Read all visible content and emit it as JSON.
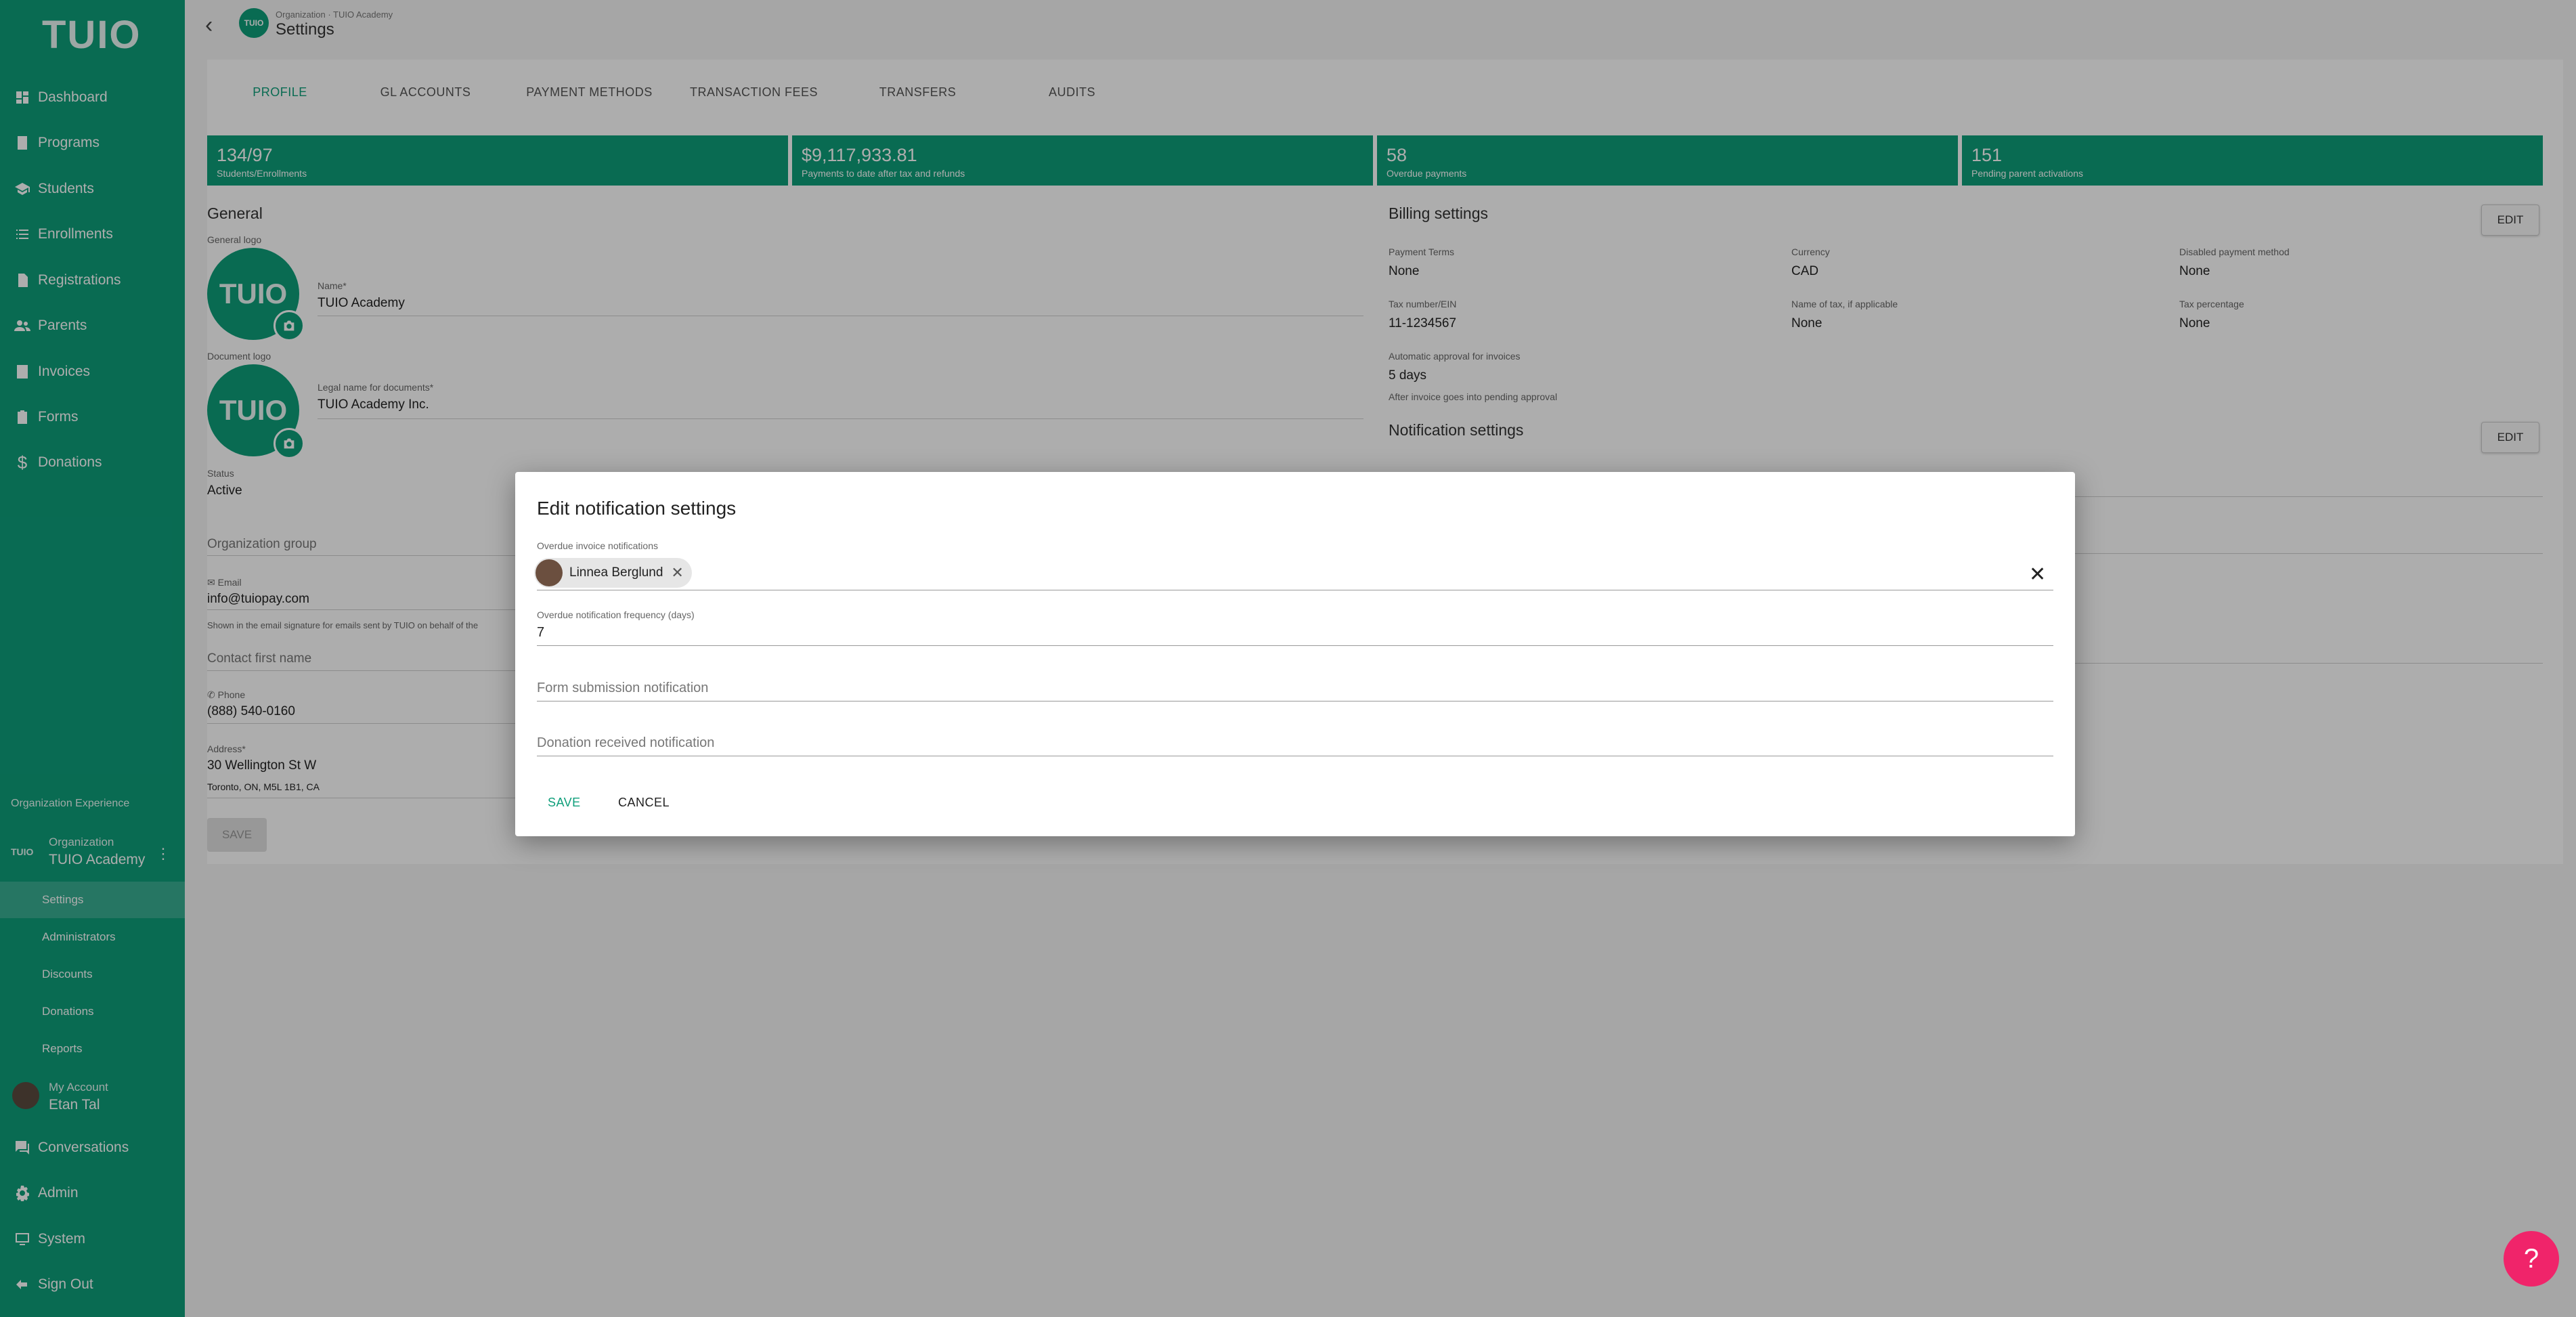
{
  "sidebar": {
    "logo": "TUIO",
    "nav": [
      {
        "label": "Dashboard",
        "icon": "dashboard-icon"
      },
      {
        "label": "Programs",
        "icon": "programs-icon"
      },
      {
        "label": "Students",
        "icon": "students-icon"
      },
      {
        "label": "Enrollments",
        "icon": "list-icon"
      },
      {
        "label": "Registrations",
        "icon": "registrations-icon"
      },
      {
        "label": "Parents",
        "icon": "parents-icon"
      },
      {
        "label": "Invoices",
        "icon": "invoices-icon"
      },
      {
        "label": "Forms",
        "icon": "forms-icon"
      },
      {
        "label": "Donations",
        "icon": "dollar-icon"
      }
    ],
    "org_experience": "Organization Experience",
    "org": {
      "tag": "TUIO",
      "label": "Organization",
      "name": "TUIO Academy"
    },
    "sub_items": [
      "Settings",
      "Administrators",
      "Discounts",
      "Donations",
      "Reports"
    ],
    "account": {
      "label": "My Account",
      "name": "Etan Tal"
    },
    "bottom_nav": [
      {
        "label": "Conversations",
        "icon": "chat-icon"
      },
      {
        "label": "Admin",
        "icon": "gear-icon"
      },
      {
        "label": "System",
        "icon": "monitor-icon"
      },
      {
        "label": "Sign Out",
        "icon": "sign-out-icon"
      }
    ]
  },
  "header": {
    "badge": "TUIO",
    "breadcrumb": "Organization · TUIO Academy",
    "title": "Settings"
  },
  "tabs": [
    "PROFILE",
    "GL ACCOUNTS",
    "PAYMENT METHODS",
    "TRANSACTION FEES",
    "TRANSFERS",
    "AUDITS"
  ],
  "stats": [
    {
      "value": "134/97",
      "label": "Students/Enrollments"
    },
    {
      "value": "$9,117,933.81",
      "label": "Payments to date after tax and refunds"
    },
    {
      "value": "58",
      "label": "Overdue payments"
    },
    {
      "value": "151",
      "label": "Pending parent activations"
    }
  ],
  "general": {
    "heading": "General",
    "general_logo_label": "General logo",
    "document_logo_label": "Document logo",
    "logo_text": "TUIO",
    "name_label": "Name*",
    "name_value": "TUIO Academy",
    "legal_label": "Legal name for documents*",
    "legal_value": "TUIO Academy Inc.",
    "status_label": "Status",
    "status_value": "Active",
    "org_group_label": "Organization group",
    "email_label": "Email",
    "email_value": "info@tuiopay.com",
    "email_help": "Shown in the email signature for emails sent by TUIO on behalf of the",
    "contact_label": "Contact first name",
    "phone_label": "Phone",
    "phone_value": "(888) 540-0160",
    "address_label": "Address*",
    "address_line1": "30 Wellington St W",
    "address_line2": "Toronto, ON, M5L 1B1, CA",
    "save": "SAVE"
  },
  "billing": {
    "heading": "Billing settings",
    "edit": "EDIT",
    "payment_terms_label": "Payment Terms",
    "payment_terms_value": "None",
    "currency_label": "Currency",
    "currency_value": "CAD",
    "disabled_pm_label": "Disabled payment method",
    "disabled_pm_value": "None",
    "tax_label": "Tax number/EIN",
    "tax_value": "11-1234567",
    "tax_name_label": "Name of tax, if applicable",
    "tax_name_value": "None",
    "tax_pct_label": "Tax percentage",
    "tax_pct_value": "None",
    "auto_label": "Automatic approval for invoices",
    "auto_value": "5 days",
    "auto_help": "After invoice goes into pending approval"
  },
  "notification": {
    "heading": "Notification settings",
    "edit": "EDIT"
  },
  "dialog": {
    "title": "Edit notification settings",
    "overdue_label": "Overdue invoice notifications",
    "chip_name": "Linnea Berglund",
    "freq_label": "Overdue notification frequency (days)",
    "freq_value": "7",
    "form_placeholder": "Form submission notification",
    "donation_placeholder": "Donation received notification",
    "save": "SAVE",
    "cancel": "CANCEL"
  },
  "help": "?",
  "colors": {
    "brand": "#0e9e7a",
    "help": "#f0246a"
  }
}
